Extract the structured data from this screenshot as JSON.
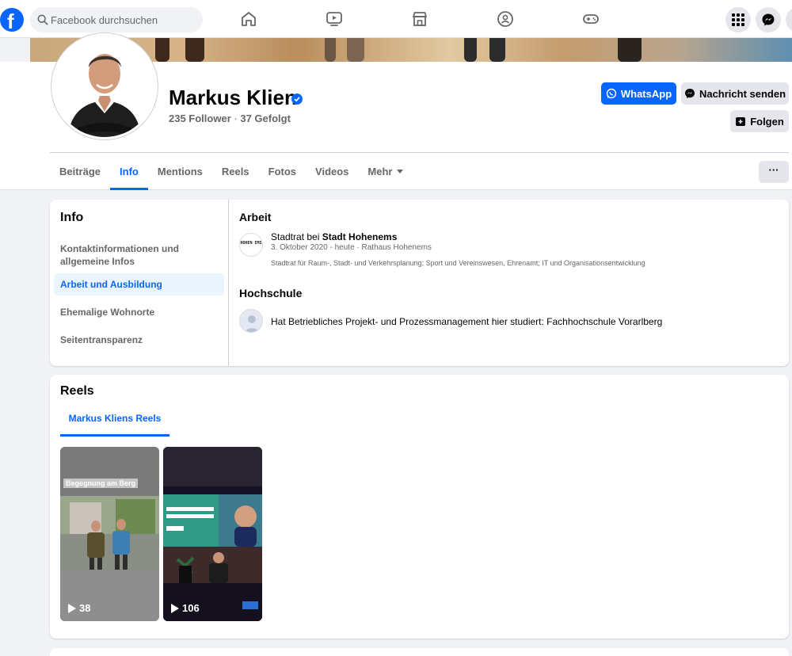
{
  "nav": {
    "logo": "f",
    "search_placeholder": "Facebook durchsuchen"
  },
  "profile": {
    "name": "Markus Klien",
    "followers": "235 Follower",
    "separator": "·",
    "following": "37 Gefolgt",
    "whatsapp_label": "WhatsApp",
    "message_label": "Nachricht senden",
    "follow_label": "Folgen",
    "more_label": "···"
  },
  "tabs": [
    {
      "label": "Beiträge"
    },
    {
      "label": "Info"
    },
    {
      "label": "Mentions"
    },
    {
      "label": "Reels"
    },
    {
      "label": "Fotos"
    },
    {
      "label": "Videos"
    },
    {
      "label": "Mehr"
    }
  ],
  "info": {
    "title": "Info",
    "menu": [
      {
        "label": "Kontaktinformationen und allgemeine Infos"
      },
      {
        "label": "Arbeit und Ausbildung"
      },
      {
        "label": "Ehemalige Wohnorte"
      },
      {
        "label": "Seitentransparenz"
      }
    ],
    "work": {
      "section_title": "Arbeit",
      "logo_text": "HOHEN EMS",
      "title_prefix": "Stadtrat bei ",
      "employer": "Stadt Hohenems",
      "sub": "3. Oktober 2020 - heute · Rathaus Hohenems",
      "description": "Stadtrat für Raum-, Stadt- und Verkehrsplanung; Sport und Vereinswesen, Ehrenamt; IT und Organisationsentwicklung"
    },
    "education": {
      "section_title": "Hochschule",
      "text": "Hat Betriebliches Projekt- und Prozessmanagement hier studiert: Fachhochschule Vorarlberg"
    }
  },
  "reels": {
    "title": "Reels",
    "tab_label": "Markus Kliens Reels",
    "items": [
      {
        "caption": "Begegnung am Berg",
        "views": "38"
      },
      {
        "views": "106"
      }
    ]
  },
  "colors": {
    "accent": "#0866ff",
    "text_secondary": "#65676b",
    "background": "#f0f2f5"
  }
}
